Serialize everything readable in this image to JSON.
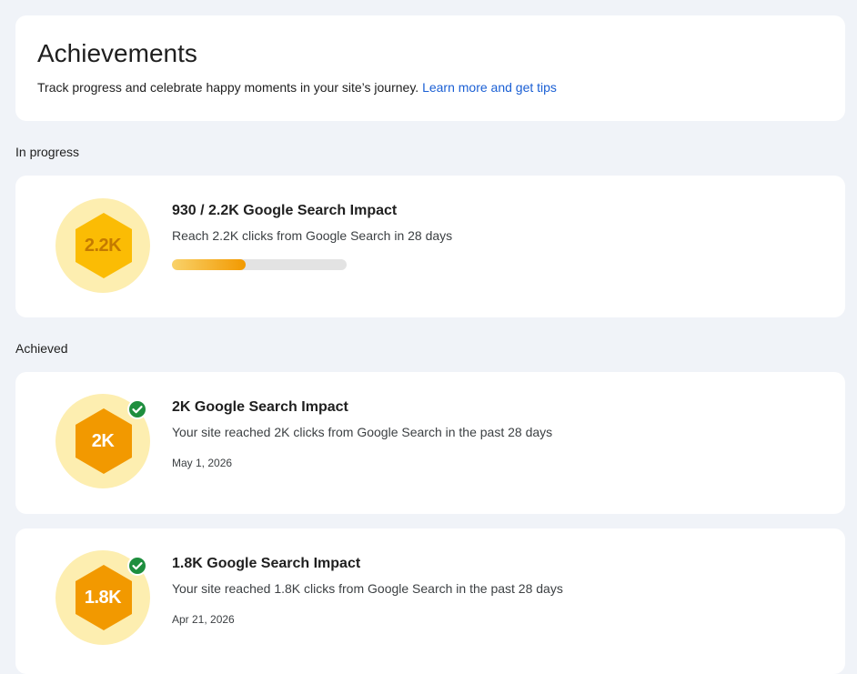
{
  "header": {
    "title": "Achievements",
    "subtitle": "Track progress and celebrate happy moments in your site’s journey.",
    "link_label": "Learn more and get tips"
  },
  "sections": {
    "in_progress_label": "In progress",
    "achieved_label": "Achieved"
  },
  "in_progress": {
    "badge_label": "2.2K",
    "badge_text_color": "#c47a00",
    "badge_hex_color": "#fbbc04",
    "title": "930 / 2.2K Google Search Impact",
    "description": "Reach 2.2K clicks from Google Search in 28 days",
    "progress": 0.42
  },
  "achieved": [
    {
      "badge_label": "2K",
      "badge_text_color": "#ffffff",
      "badge_hex_color": "#f29900",
      "title": "2K Google Search Impact",
      "description": "Your site reached 2K clicks from Google Search in the past 28 days",
      "date": "May 1, 2026",
      "check_icon": "check-circle-icon"
    },
    {
      "badge_label": "1.8K",
      "badge_text_color": "#ffffff",
      "badge_hex_color": "#f29900",
      "title": "1.8K Google Search Impact",
      "description": "Your site reached 1.8K clicks from Google Search in the past 28 days",
      "date": "Apr 21, 2026",
      "check_icon": "check-circle-icon"
    }
  ],
  "colors": {
    "badge_circle": "#fdeeb0",
    "check_green": "#1e8e3e",
    "link_blue": "#1a5fd4"
  }
}
